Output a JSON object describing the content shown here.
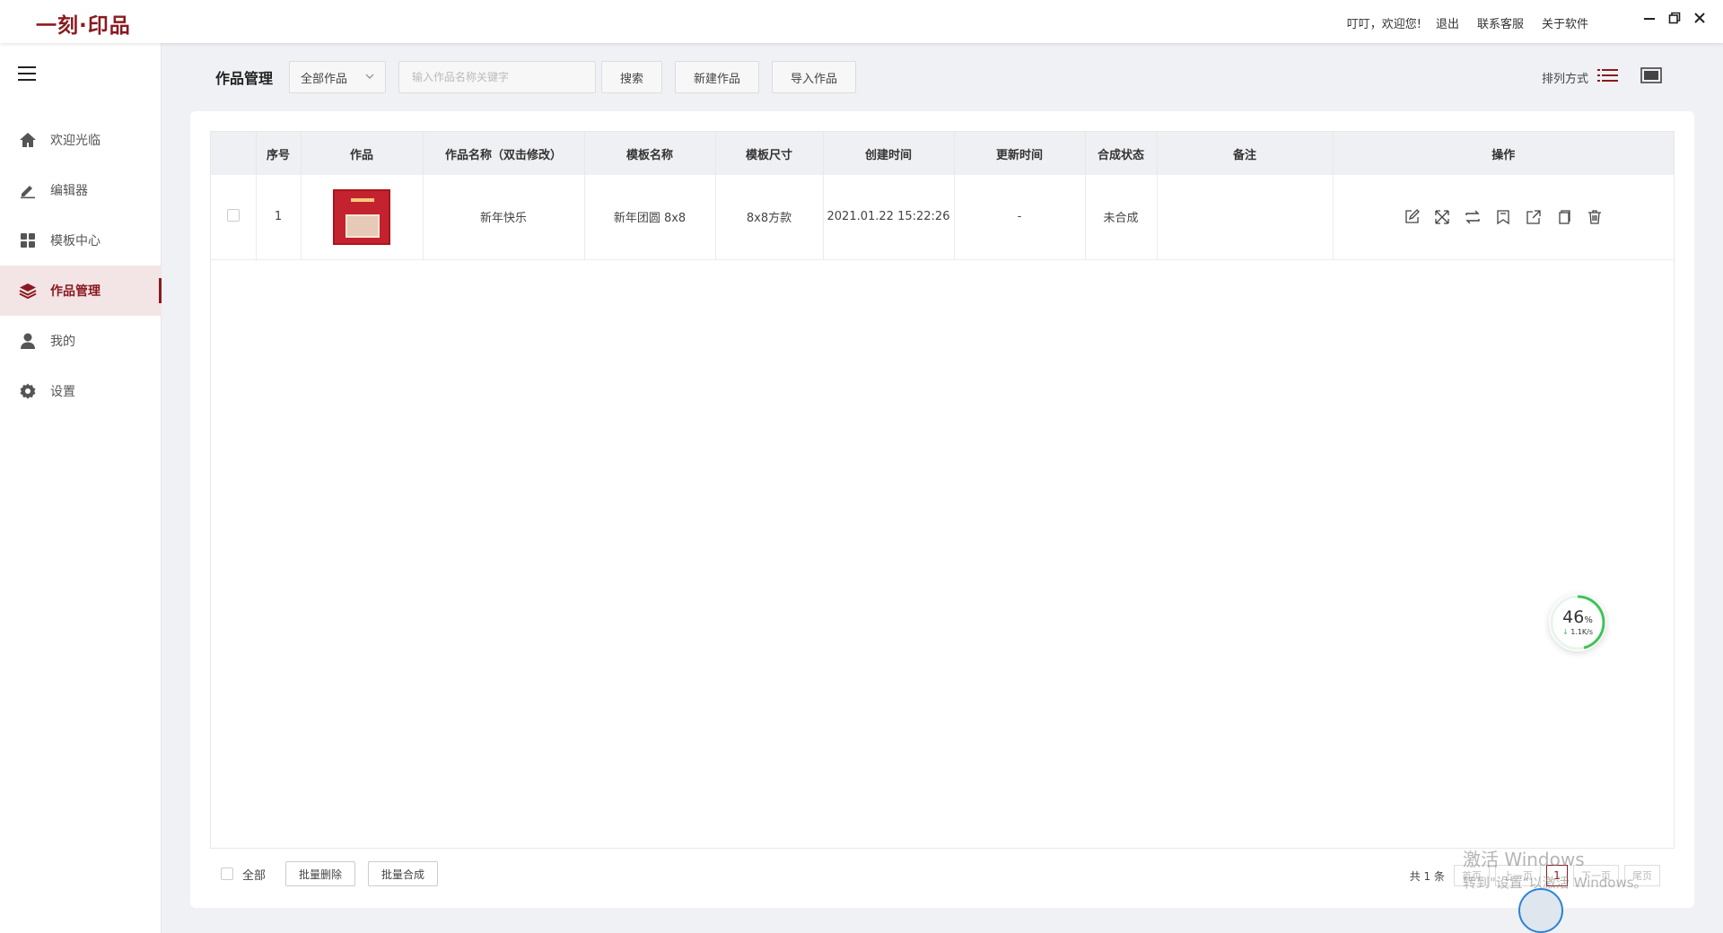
{
  "app": {
    "logo": "一刻·印品",
    "greeting": "叮叮，欢迎您!",
    "links": [
      "退出",
      "联系客服",
      "关于软件"
    ]
  },
  "sidebar": {
    "items": [
      {
        "label": "欢迎光临",
        "icon": "home-icon"
      },
      {
        "label": "编辑器",
        "icon": "pencil-icon"
      },
      {
        "label": "模板中心",
        "icon": "grid-icon"
      },
      {
        "label": "作品管理",
        "icon": "layers-icon",
        "active": true
      },
      {
        "label": "我的",
        "icon": "user-icon"
      },
      {
        "label": "设置",
        "icon": "gear-icon"
      }
    ]
  },
  "toolbar": {
    "title": "作品管理",
    "filter_value": "全部作品",
    "search_placeholder": "输入作品名称关键字",
    "search_label": "搜索",
    "new_label": "新建作品",
    "import_label": "导入作品",
    "sort_label": "排列方式"
  },
  "table": {
    "headers": [
      "序号",
      "作品",
      "作品名称（双击修改）",
      "模板名称",
      "模板尺寸",
      "创建时间",
      "更新时间",
      "合成状态",
      "备注",
      "操作"
    ],
    "rows": [
      {
        "index": "1",
        "name": "新年快乐",
        "template": "新年团圆 8x8",
        "size": "8x8方款",
        "created": "2021.01.22 15:22:26",
        "updated": "-",
        "status": "未合成",
        "note": ""
      }
    ],
    "row_actions": [
      "edit-icon",
      "expand-icon",
      "swap-icon",
      "bookmark-icon",
      "share-icon",
      "copy-icon",
      "delete-icon"
    ]
  },
  "footer": {
    "select_all": "全部",
    "batch_delete": "批量删除",
    "batch_compose": "批量合成",
    "total": "共 1 条",
    "first": "首页",
    "prev": "上一页",
    "current_page": "1",
    "next": "下一页",
    "last": "尾页"
  },
  "speed_widget": {
    "percent": "46",
    "unit": "%",
    "rate": "1.1K/s"
  },
  "watermark": {
    "line1": "激活 Windows",
    "line2": "转到\"设置\"以激活 Windows。"
  },
  "colors": {
    "accent": "#8a1a20",
    "panel": "#ffffff",
    "background": "#f0f1f4"
  }
}
